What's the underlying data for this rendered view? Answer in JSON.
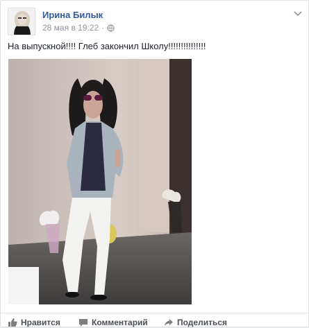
{
  "post": {
    "author": "Ирина Билык",
    "timestamp": "28 мая в 19:22",
    "separator": "·",
    "privacy_icon": "globe-icon",
    "text": "На выпускной!!!! Глеб закончил Школу!!!!!!!!!!!!!!!"
  },
  "actions": {
    "like_label": "Нравится",
    "comment_label": "Комментарий",
    "share_label": "Поделиться"
  },
  "colors": {
    "link": "#365899",
    "meta": "#90949c",
    "action": "#4b4f56"
  }
}
